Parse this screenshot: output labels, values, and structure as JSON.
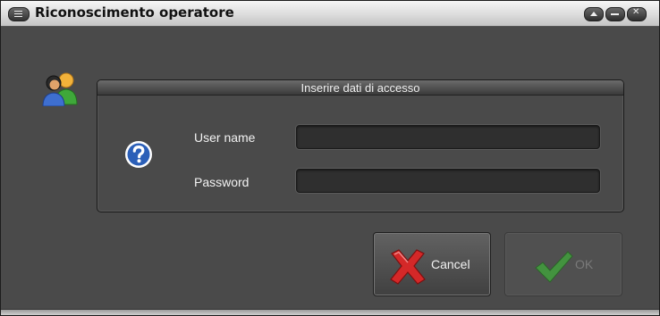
{
  "window": {
    "title": "Riconoscimento operatore",
    "controls": [
      "menu-icon",
      "maximize-icon",
      "minimize-icon",
      "close-icon"
    ]
  },
  "login": {
    "group_title": "Inserire dati di accesso",
    "user_label": "User name",
    "user_value": "",
    "password_label": "Password",
    "password_value": ""
  },
  "buttons": {
    "cancel_label": "Cancel",
    "ok_label": "OK",
    "ok_enabled": false
  },
  "icons": {
    "users": "users-icon",
    "help": "question-icon",
    "cancel": "red-x-icon",
    "ok": "green-check-icon"
  },
  "colors": {
    "background": "#4a4a4a",
    "help_blue": "#2b5fb8",
    "cancel_red": "#d42828",
    "ok_green": "#3faa3a"
  }
}
